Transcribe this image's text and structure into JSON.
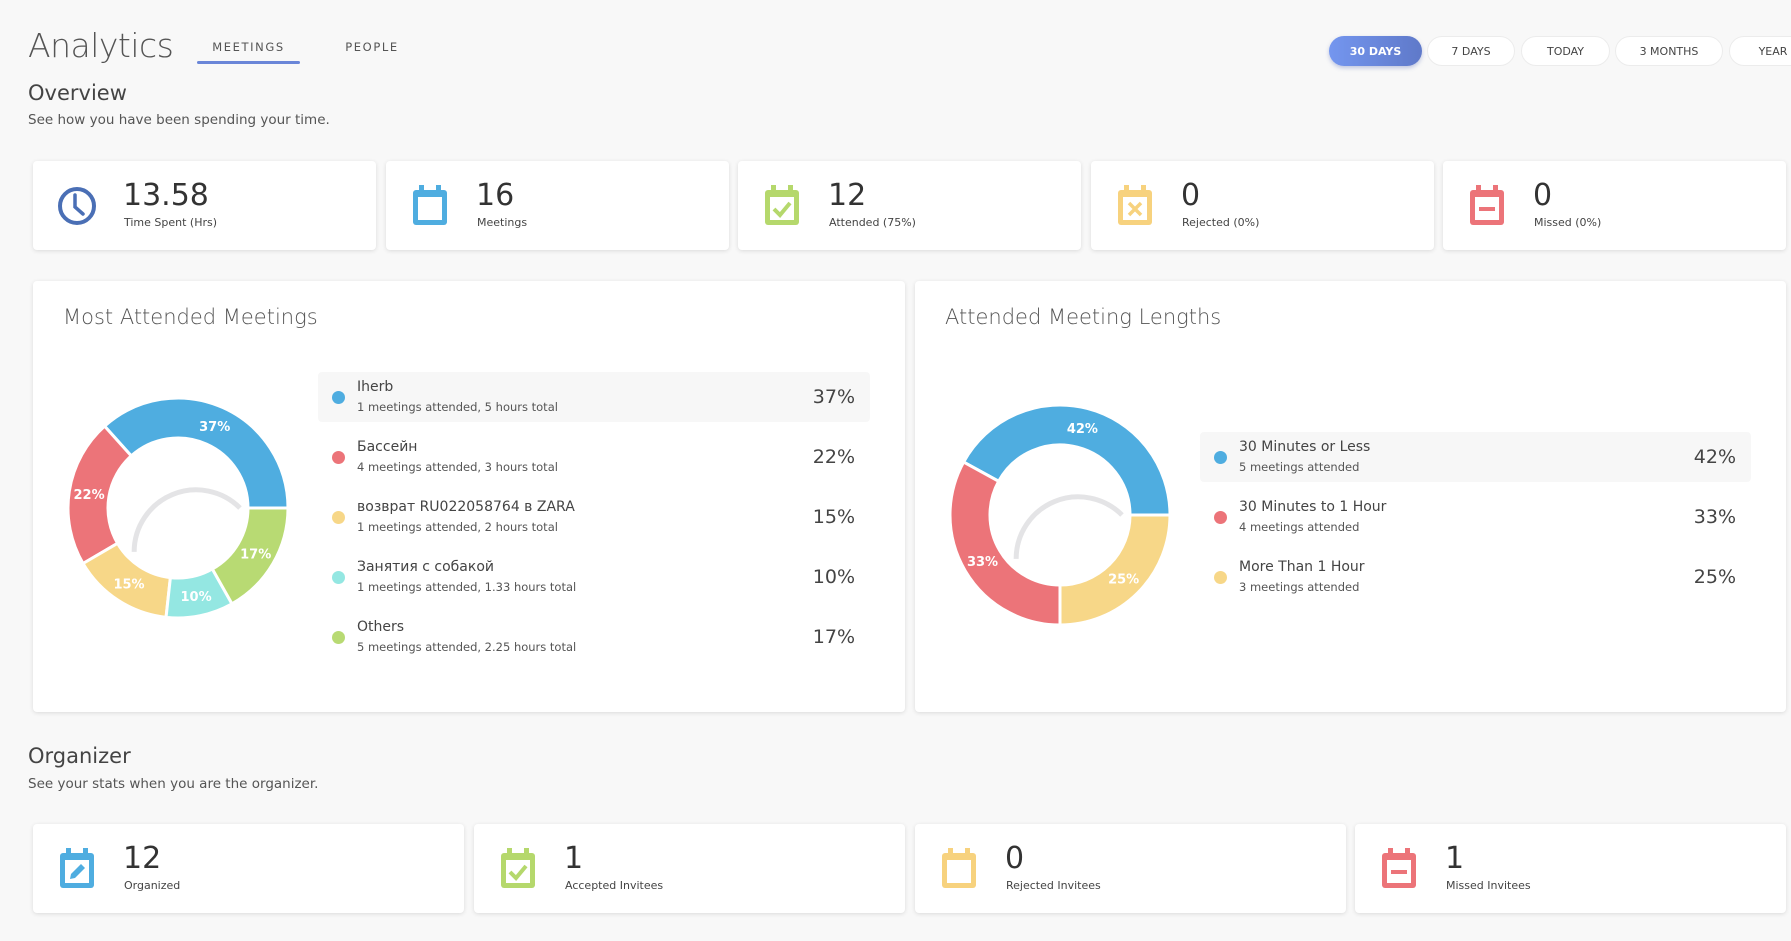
{
  "header": {
    "title": "Analytics",
    "tabs": [
      {
        "label": "MEETINGS",
        "active": true
      },
      {
        "label": "PEOPLE",
        "active": false
      }
    ],
    "ranges": [
      {
        "label": "30 DAYS",
        "active": true
      },
      {
        "label": "7 DAYS",
        "active": false
      },
      {
        "label": "TODAY",
        "active": false
      },
      {
        "label": "3 MONTHS",
        "active": false
      },
      {
        "label": "YEAR",
        "active": false
      }
    ]
  },
  "overview": {
    "title": "Overview",
    "subtitle": "See how you have been spending your time.",
    "stats": [
      {
        "value": "13.58",
        "label": "Time Spent (Hrs)",
        "icon": "clock-icon",
        "color": "#4a6fb5"
      },
      {
        "value": "16",
        "label": "Meetings",
        "icon": "calendar-icon",
        "color": "#4fade0"
      },
      {
        "value": "12",
        "label": "Attended (75%)",
        "icon": "calendar-check-icon",
        "color": "#b5d86c"
      },
      {
        "value": "0",
        "label": "Rejected (0%)",
        "icon": "calendar-x-icon",
        "color": "#f7d27e"
      },
      {
        "value": "0",
        "label": "Missed (0%)",
        "icon": "calendar-minus-icon",
        "color": "#ec7479"
      }
    ]
  },
  "chart_data": [
    {
      "type": "pie",
      "title": "Most Attended Meetings",
      "categories": [
        "Iherb",
        "Бассейн",
        "возврат RU022058764 в ZARA",
        "Занятия с собакой",
        "Others"
      ],
      "values": [
        37,
        22,
        15,
        10,
        17
      ],
      "labels": [
        "37%",
        "22%",
        "15%",
        "10%",
        "17%"
      ],
      "details": [
        "1 meetings attended, 5 hours total",
        "4 meetings attended, 3 hours total",
        "1 meetings attended, 2 hours total",
        "1 meetings attended, 1.33 hours total",
        "5 meetings attended, 2.25 hours total"
      ],
      "colors": [
        "#4fade0",
        "#ec7479",
        "#f7d788",
        "#94e7e2",
        "#b8da73"
      ],
      "highlighted_index": 0,
      "legend": "right"
    },
    {
      "type": "pie",
      "title": "Attended Meeting Lengths",
      "categories": [
        "30 Minutes or Less",
        "30 Minutes to 1 Hour",
        "More Than 1 Hour"
      ],
      "values": [
        42,
        33,
        25
      ],
      "labels": [
        "42%",
        "33%",
        "25%"
      ],
      "details": [
        "5 meetings attended",
        "4 meetings attended",
        "3 meetings attended"
      ],
      "colors": [
        "#4fade0",
        "#ec7479",
        "#f7d788"
      ],
      "highlighted_index": 0,
      "legend": "right"
    }
  ],
  "organizer": {
    "title": "Organizer",
    "subtitle": "See your stats when you are the organizer.",
    "stats": [
      {
        "value": "12",
        "label": "Organized",
        "icon": "calendar-edit-icon",
        "color": "#4fade0"
      },
      {
        "value": "1",
        "label": "Accepted Invitees",
        "icon": "calendar-check-icon",
        "color": "#b5d86c"
      },
      {
        "value": "0",
        "label": "Rejected Invitees",
        "icon": "calendar-icon",
        "color": "#f7d27e"
      },
      {
        "value": "1",
        "label": "Missed Invitees",
        "icon": "calendar-minus-icon",
        "color": "#ec7479"
      }
    ]
  }
}
